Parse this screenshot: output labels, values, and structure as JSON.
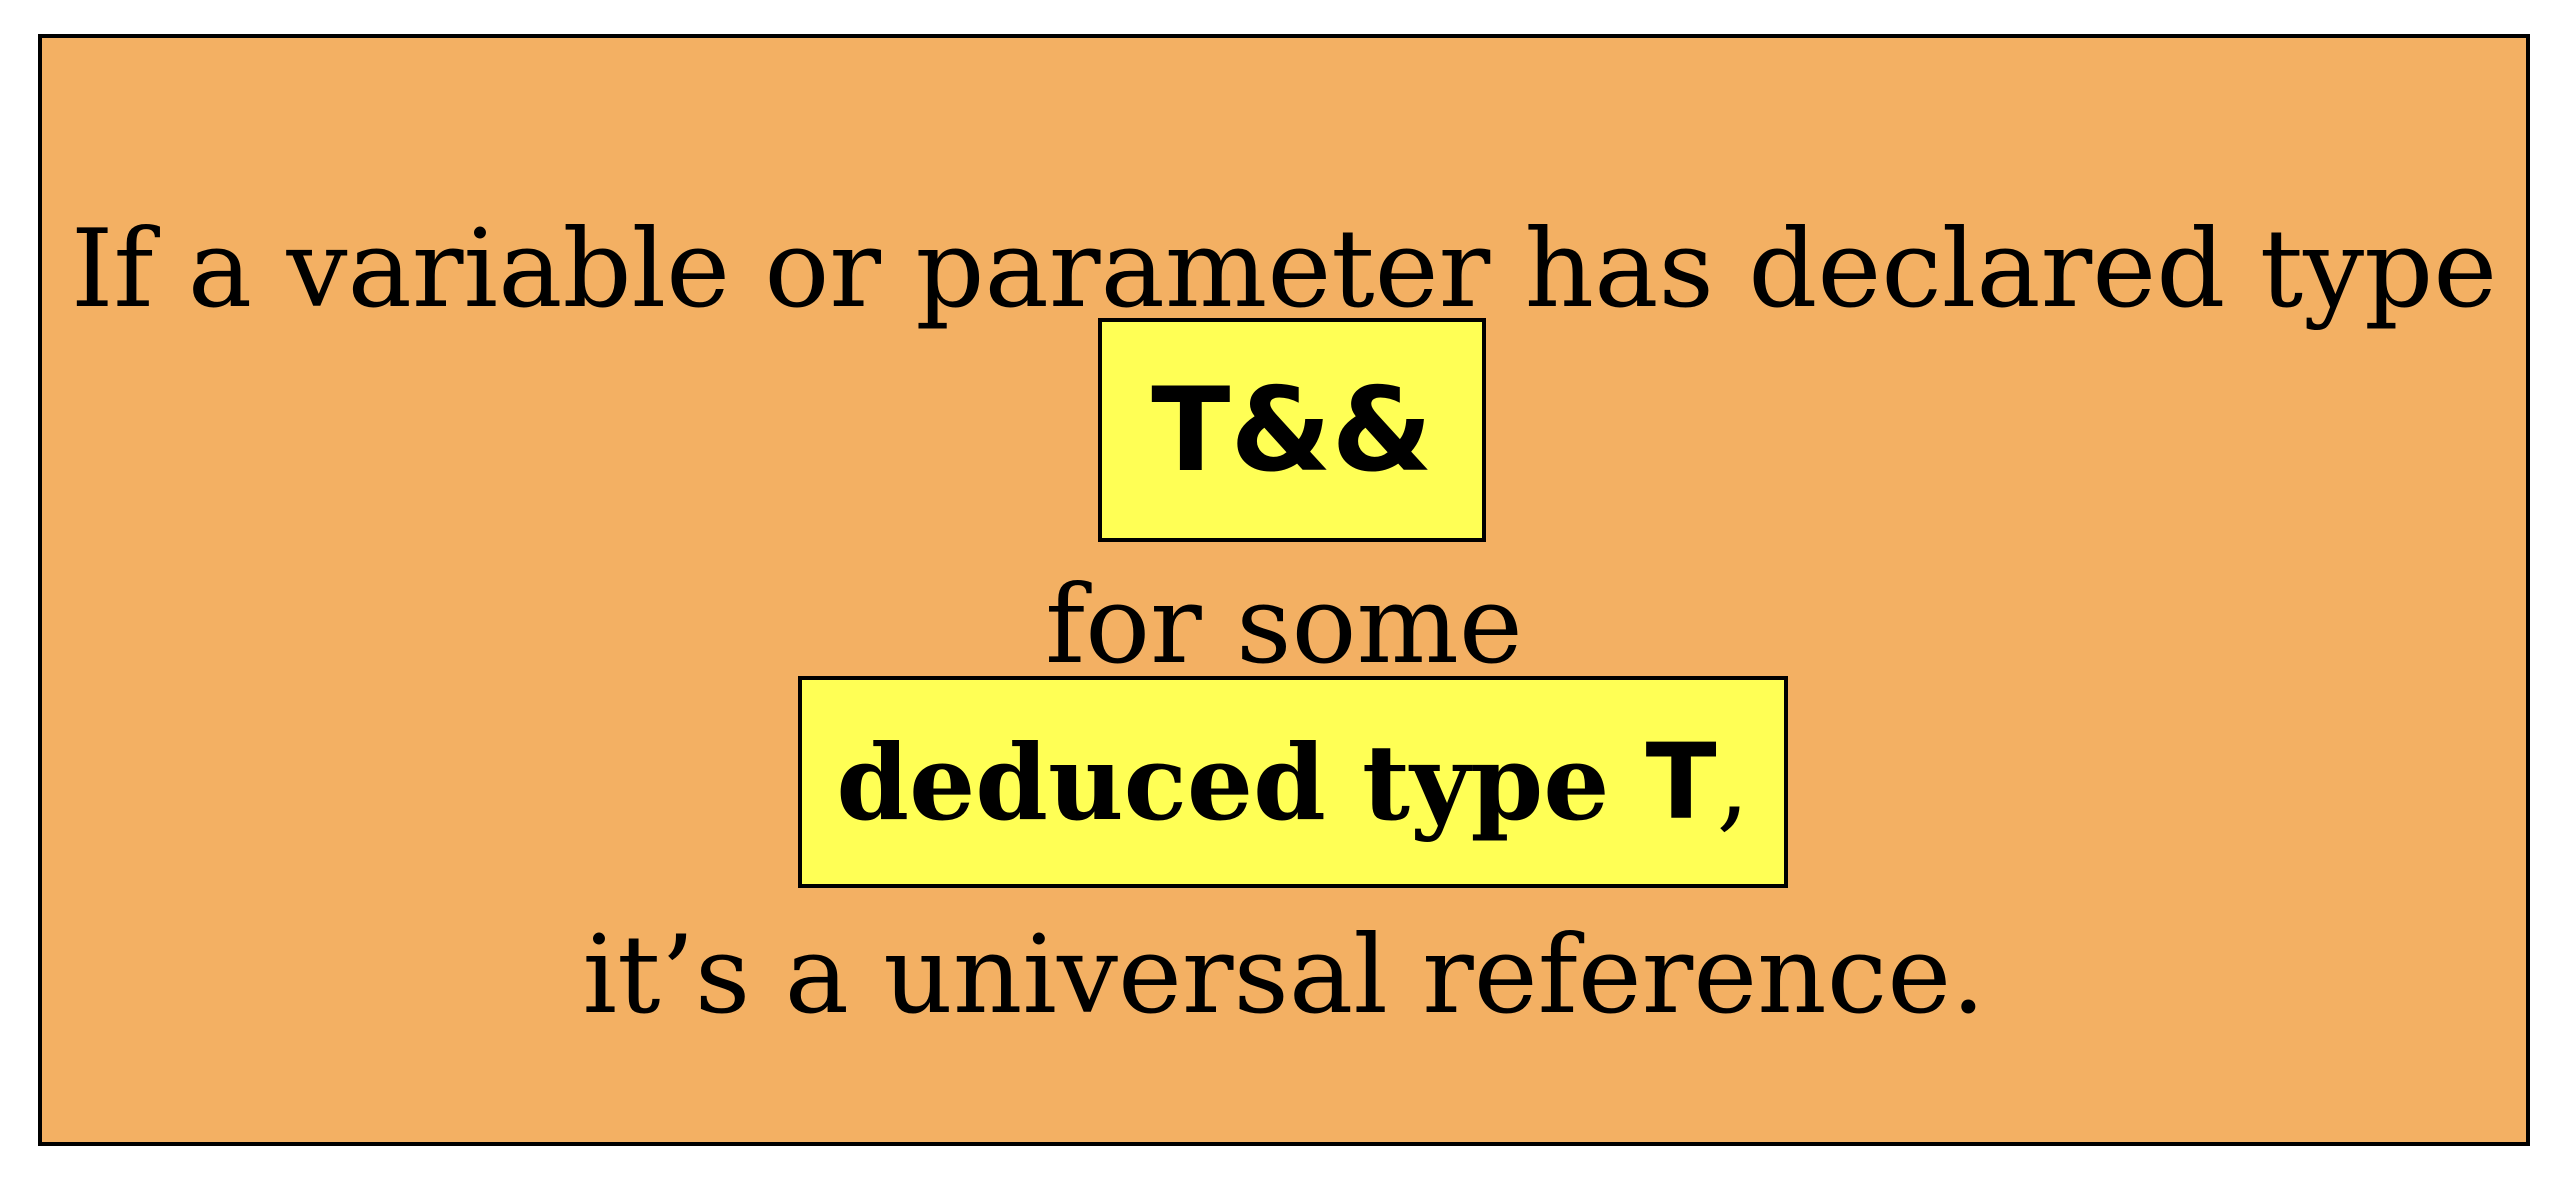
{
  "diagram": {
    "line1": "If a variable or parameter has declared type",
    "box1_text": "T&&",
    "line3": "for some",
    "box2_text": "deduced type",
    "box2_code": "T",
    "box2_punct": ",",
    "line5": "it’s a universal reference."
  },
  "colors": {
    "panel_background": "#f3b063",
    "highlight_background": "#ffff55",
    "border": "#000000"
  }
}
